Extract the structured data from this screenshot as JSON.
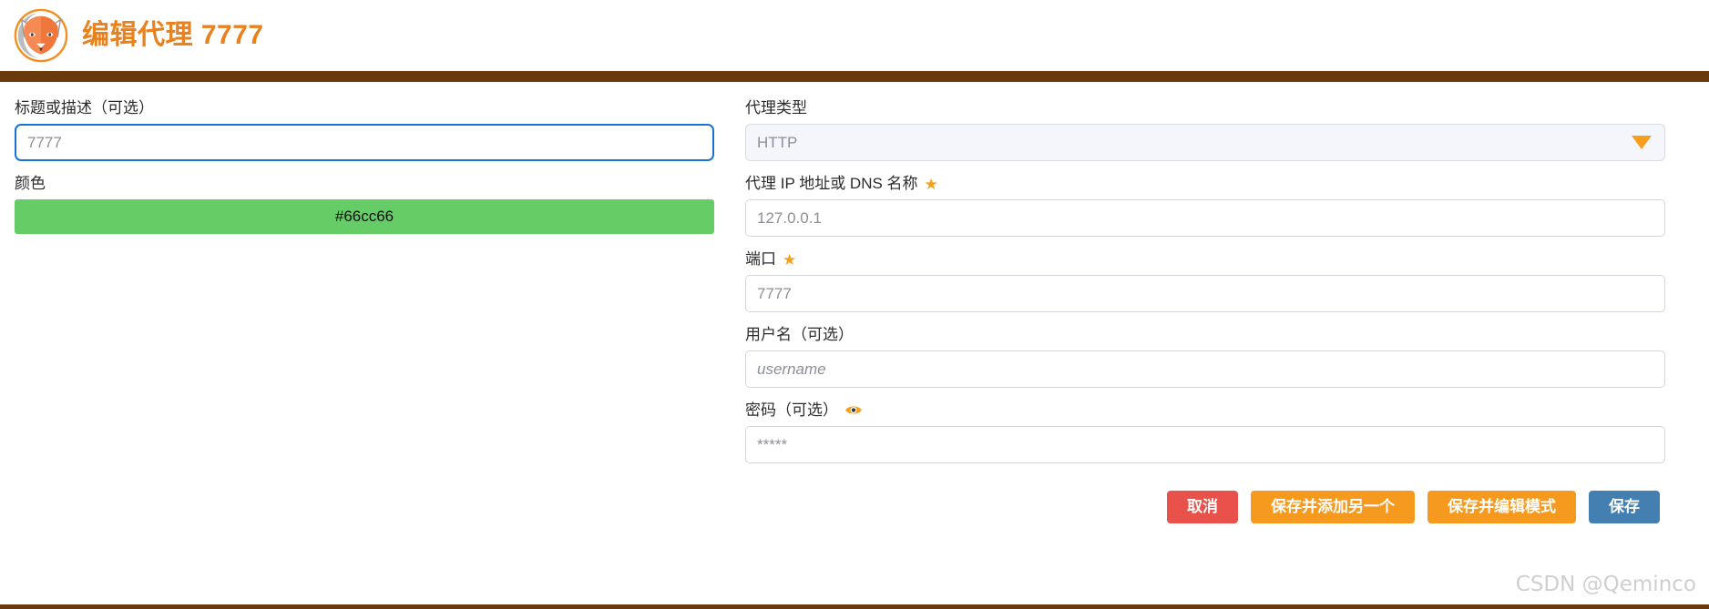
{
  "header": {
    "logo_alt": "foxyproxy-fox-logo",
    "title": "编辑代理 7777"
  },
  "left_column": {
    "title_field": {
      "label": "标题或描述（可选）",
      "value": "7777",
      "placeholder": "7777",
      "focused": true
    },
    "color_field": {
      "label": "颜色",
      "value": "#66cc66",
      "swatch_color": "#66cc66",
      "text_color": "#111111"
    }
  },
  "right_column": {
    "proxy_type_field": {
      "label": "代理类型",
      "value": "HTTP",
      "options": [
        "HTTP"
      ],
      "caret_icon": "chevron-down-icon",
      "caret_color": "#f79f1b"
    },
    "host_field": {
      "label": "代理 IP 地址或 DNS 名称",
      "required_icon": "star-icon",
      "star": "★",
      "value": "127.0.0.1",
      "placeholder": "127.0.0.1"
    },
    "port_field": {
      "label": "端口",
      "required_icon": "star-icon",
      "star": "★",
      "value": "7777",
      "placeholder": "7777"
    },
    "username_field": {
      "label": "用户名（可选）",
      "value": "",
      "placeholder": "username"
    },
    "password_field": {
      "label": "密码（可选）",
      "reveal_icon": "eye-icon",
      "eye": "👁",
      "value": "",
      "placeholder": "*****"
    }
  },
  "buttons": {
    "cancel": "取消",
    "save_and_add_another": "保存并添加另一个",
    "save_and_edit_patterns": "保存并编辑模式",
    "save": "保存"
  },
  "watermark": "CSDN @Qeminco",
  "colors": {
    "accent_orange": "#e8821e",
    "divider_brown": "#6b3a0c",
    "focus_blue": "#1673d4",
    "cancel_red": "#e8524a",
    "save_blue": "#447fb2",
    "button_orange": "#f59a1e",
    "swatch_green": "#66cc66"
  }
}
